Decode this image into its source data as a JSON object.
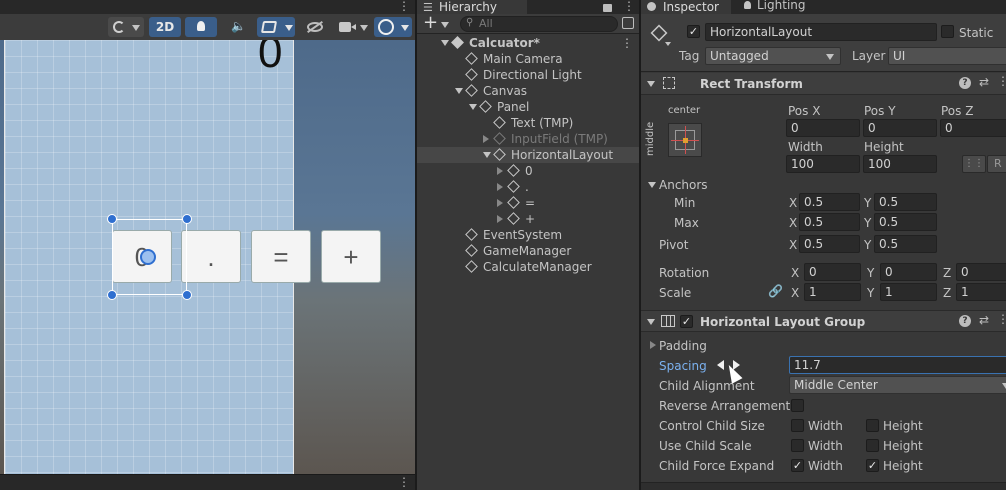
{
  "scene": {
    "toolbar": {
      "btn_2d": "2D",
      "icons": [
        "shading-mode-icon",
        "lighting-icon",
        "audio-icon",
        "effects-icon",
        "visibility-icon",
        "camera-icon",
        "gizmos-icon"
      ]
    },
    "canvas_text": "0",
    "buttons": [
      "0",
      ".",
      "=",
      "+"
    ]
  },
  "hierarchy": {
    "tab_label": "Hierarchy",
    "search_placeholder": "All",
    "items": [
      {
        "label": "Calcuator*",
        "depth": 0,
        "bold": true
      },
      {
        "label": "Main Camera",
        "depth": 1
      },
      {
        "label": "Directional Light",
        "depth": 1
      },
      {
        "label": "Canvas",
        "depth": 1
      },
      {
        "label": "Panel",
        "depth": 2
      },
      {
        "label": "Text (TMP)",
        "depth": 3
      },
      {
        "label": "InputField (TMP)",
        "depth": 3,
        "dim": true
      },
      {
        "label": "HorizontalLayout",
        "depth": 3,
        "selected": true
      },
      {
        "label": "0",
        "depth": 4
      },
      {
        "label": ".",
        "depth": 4
      },
      {
        "label": "=",
        "depth": 4
      },
      {
        "label": "+",
        "depth": 4
      },
      {
        "label": "EventSystem",
        "depth": 1
      },
      {
        "label": "GameManager",
        "depth": 1
      },
      {
        "label": "CalculateManager",
        "depth": 1
      }
    ]
  },
  "inspector": {
    "tab_label": "Inspector",
    "lighting_tab_label": "Lighting",
    "object_name": "HorizontalLayout",
    "static_label": "Static",
    "tag_label": "Tag",
    "tag_value": "Untagged",
    "layer_label": "Layer",
    "layer_value": "UI",
    "rect": {
      "title": "Rect Transform",
      "anchor_h": "center",
      "anchor_v": "middle",
      "posx_label": "Pos X",
      "posx": "0",
      "posy_label": "Pos Y",
      "posy": "0",
      "posz_label": "Pos Z",
      "posz": "0",
      "width_label": "Width",
      "width": "100",
      "height_label": "Height",
      "height": "100",
      "r_label": "R",
      "anchors_label": "Anchors",
      "min_label": "Min",
      "min_x": "0.5",
      "min_y": "0.5",
      "max_label": "Max",
      "max_x": "0.5",
      "max_y": "0.5",
      "pivot_label": "Pivot",
      "pivot_x": "0.5",
      "pivot_y": "0.5",
      "rotation_label": "Rotation",
      "rot_x": "0",
      "rot_y": "0",
      "rot_z": "0",
      "scale_label": "Scale",
      "scale_x": "1",
      "scale_y": "1",
      "scale_z": "1",
      "x": "X",
      "y": "Y",
      "z": "Z"
    },
    "hlg": {
      "title": "Horizontal Layout Group",
      "padding_label": "Padding",
      "spacing_label": "Spacing",
      "spacing_value": "11.7",
      "child_alignment_label": "Child Alignment",
      "child_alignment_value": "Middle Center",
      "reverse_label": "Reverse Arrangement",
      "control_size_label": "Control Child Size",
      "use_scale_label": "Use Child Scale",
      "force_expand_label": "Child Force Expand",
      "width_label": "Width",
      "height_label": "Height",
      "control_width": false,
      "control_height": false,
      "scale_width": false,
      "scale_height": false,
      "expand_width": true,
      "expand_height": true
    }
  },
  "colors": {
    "accent": "#3a72b0",
    "selected_row": "#3a3a3a",
    "panel_bg": "#383838",
    "scene_blue": "#a6c0d8"
  }
}
